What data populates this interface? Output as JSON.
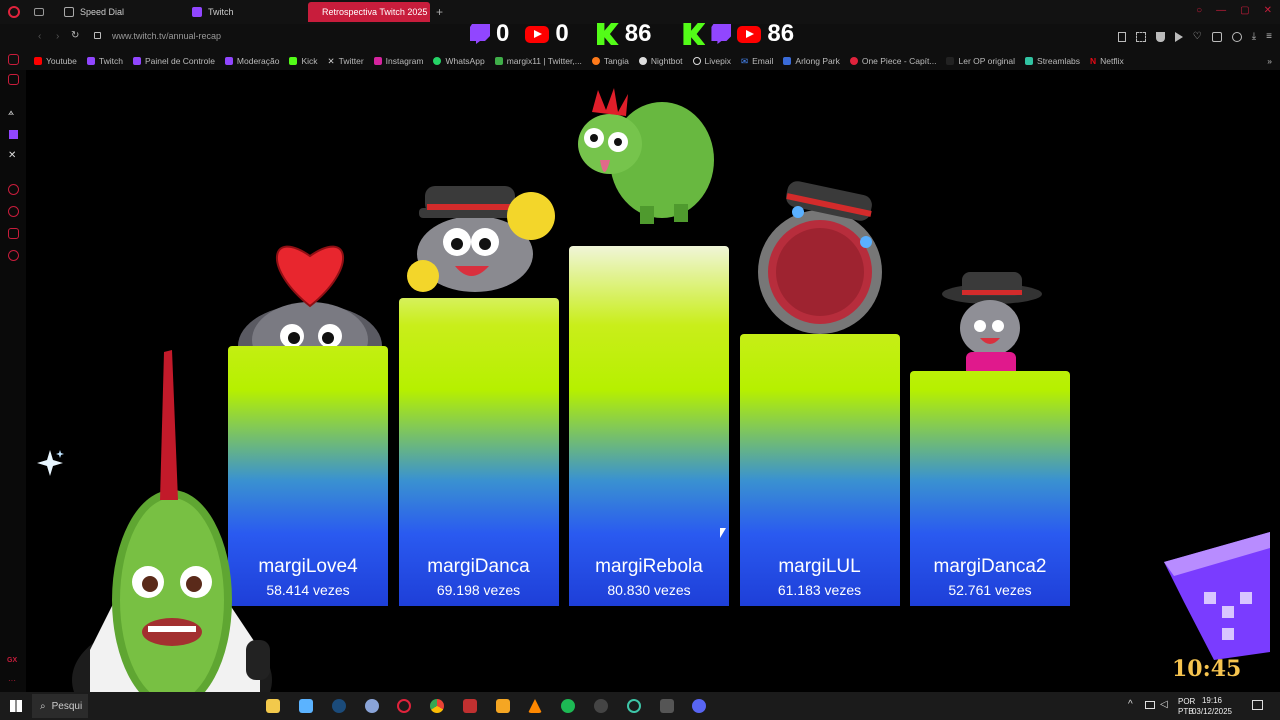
{
  "browser": {
    "tabs": [
      {
        "label": "Speed Dial"
      },
      {
        "label": "Twitch"
      },
      {
        "label": "Retrospectiva Twitch 2025"
      }
    ],
    "url": "www.twitch.tv/annual-recap",
    "bookmarks": [
      "Youtube",
      "Twitch",
      "Painel de Controle",
      "Moderação",
      "Kick",
      "Twitter",
      "Instagram",
      "WhatsApp",
      "margix11 | Twitter,...",
      "Tangia",
      "Nightbot",
      "Livepix",
      "Email",
      "Arlong Park",
      "One Piece - Capít...",
      "Ler OP original",
      "Streamlabs",
      "Netflix"
    ]
  },
  "overlay": {
    "twitch_count": "0",
    "youtube_count": "0",
    "kick_count": "86",
    "total_count": "86",
    "clock": "10:45"
  },
  "chart_data": {
    "type": "bar",
    "categories": [
      "margiLove4",
      "margiDanca",
      "margiRebola",
      "margiLUL",
      "margiDanca2"
    ],
    "values": [
      58414,
      69198,
      80830,
      61183,
      52761
    ],
    "labels": [
      "58.414 vezes",
      "69.198 vezes",
      "80.830 vezes",
      "61.183 vezes",
      "52.761 vezes"
    ]
  },
  "taskbar": {
    "search_placeholder": "Pesqui",
    "lang_top": "POR",
    "lang_bottom": "PTB",
    "time": "19:16",
    "date": "03/12/2025"
  },
  "colors": {
    "accent": "#c81d3c",
    "twitch": "#9146ff",
    "youtube": "#ff0000",
    "kick": "#53fc18"
  }
}
